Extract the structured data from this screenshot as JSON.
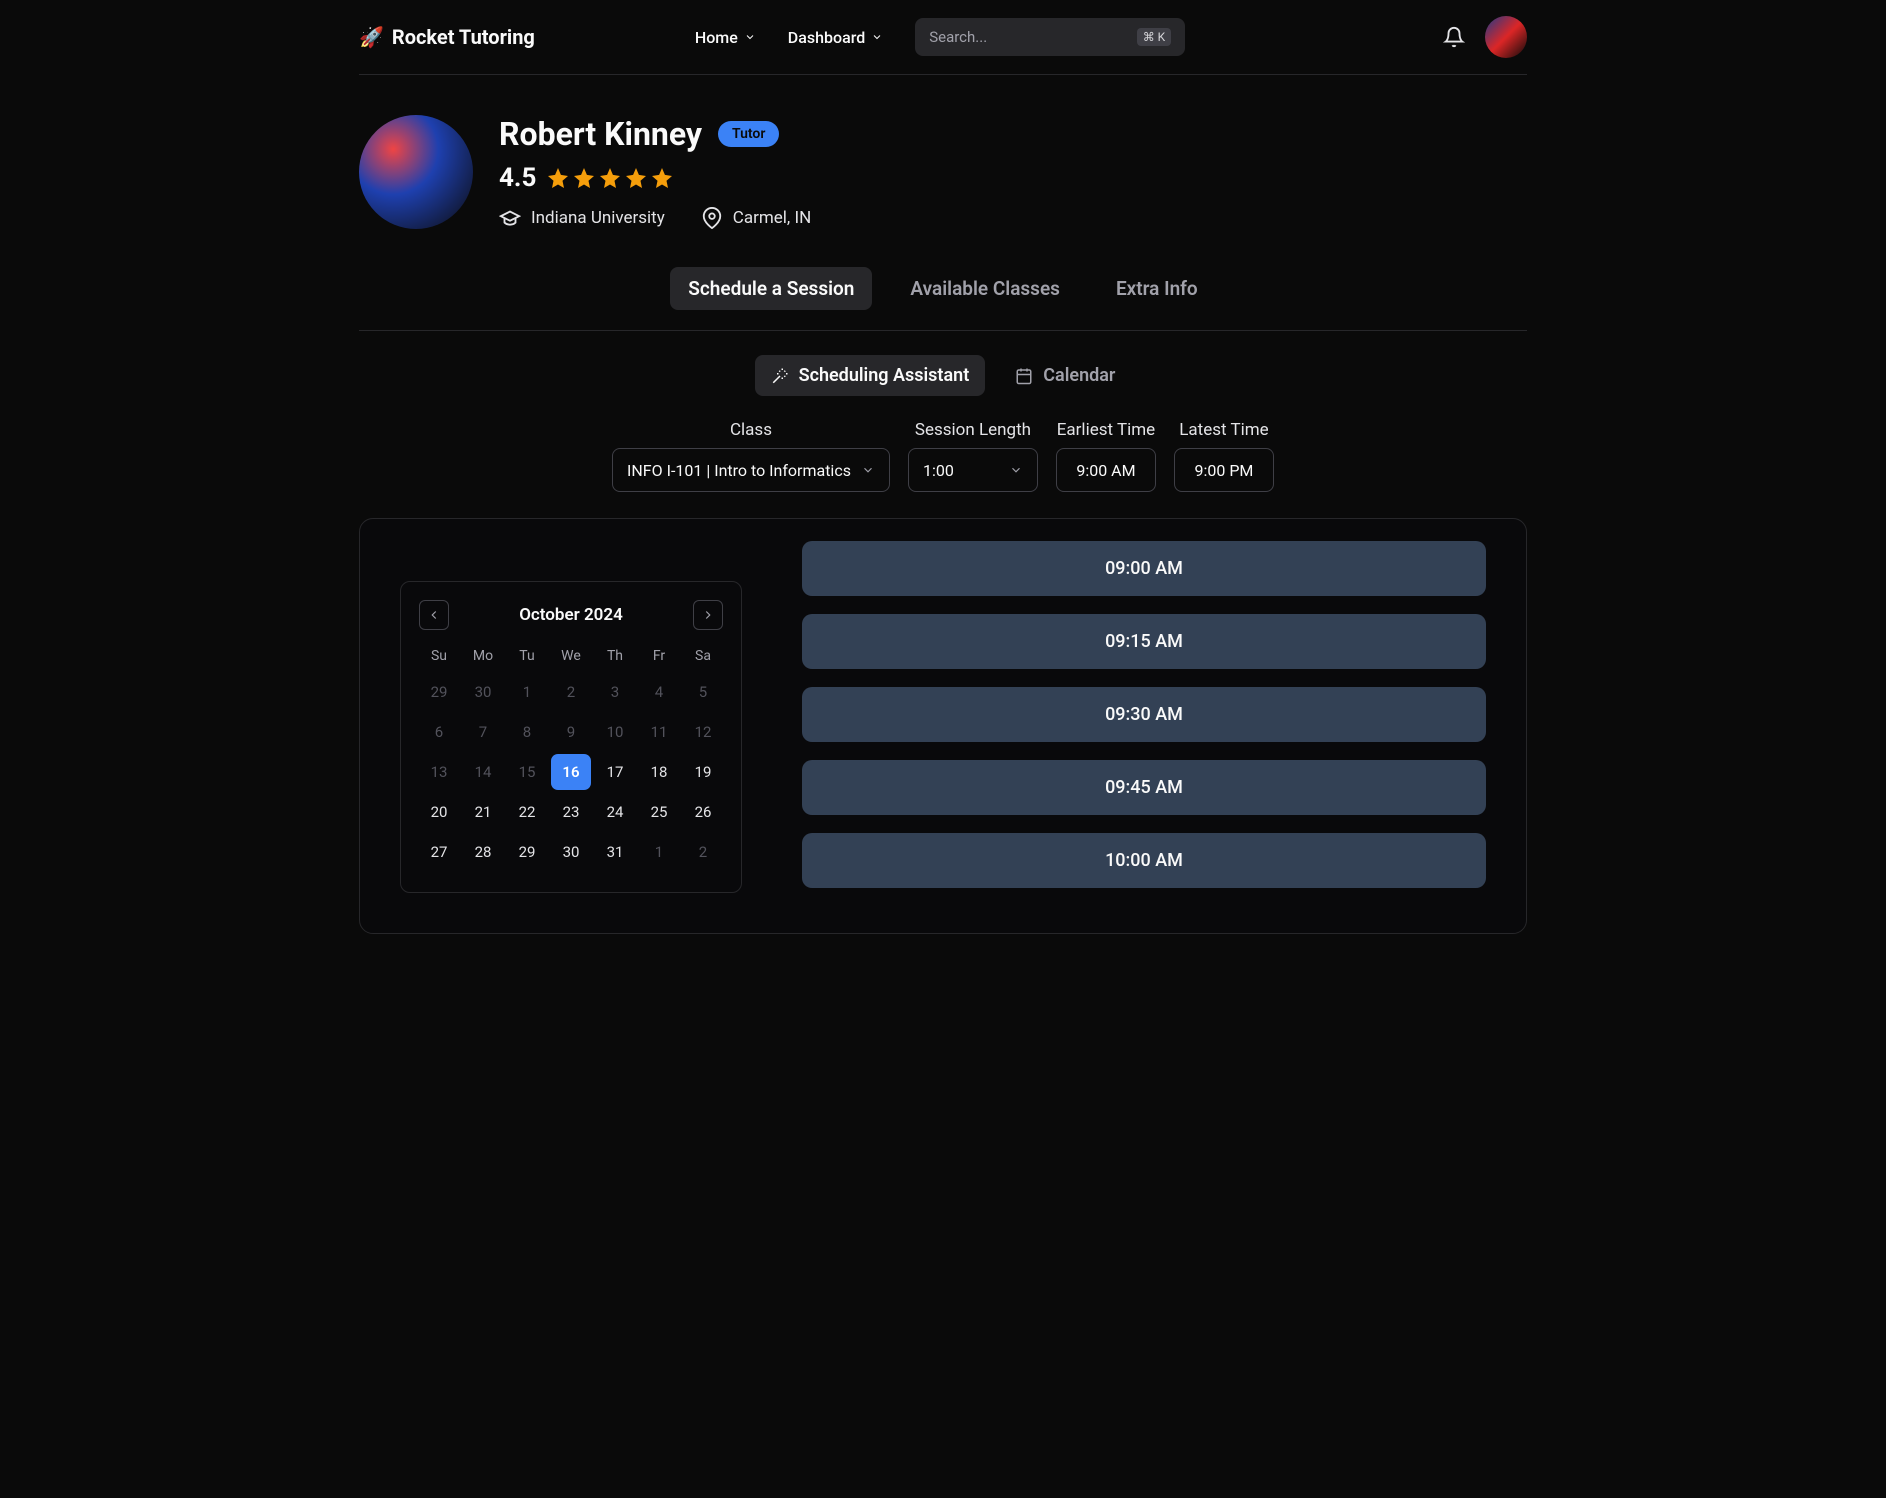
{
  "header": {
    "brand_emoji": "🚀",
    "brand_name": "Rocket Tutoring",
    "nav": [
      {
        "label": "Home"
      },
      {
        "label": "Dashboard"
      }
    ],
    "search_placeholder": "Search...",
    "search_kbd": "⌘ K"
  },
  "profile": {
    "name": "Robert Kinney",
    "badge": "Tutor",
    "rating": "4.5",
    "university": "Indiana University",
    "location": "Carmel, IN"
  },
  "tabs": [
    {
      "label": "Schedule a Session",
      "active": true
    },
    {
      "label": "Available Classes",
      "active": false
    },
    {
      "label": "Extra Info",
      "active": false
    }
  ],
  "subtabs": [
    {
      "label": "Scheduling Assistant",
      "active": true,
      "icon": "wand-icon"
    },
    {
      "label": "Calendar",
      "active": false,
      "icon": "calendar-icon"
    }
  ],
  "filters": {
    "class_label": "Class",
    "class_value": "INFO I-101 | Intro to Informatics",
    "session_length_label": "Session Length",
    "session_length_value": "1:00",
    "earliest_label": "Earliest Time",
    "earliest_value": "9:00 AM",
    "latest_label": "Latest Time",
    "latest_value": "9:00 PM"
  },
  "calendar": {
    "month_label": "October 2024",
    "dows": [
      "Su",
      "Mo",
      "Tu",
      "We",
      "Th",
      "Fr",
      "Sa"
    ],
    "days": [
      {
        "n": "29",
        "muted": true
      },
      {
        "n": "30",
        "muted": true
      },
      {
        "n": "1",
        "muted": true
      },
      {
        "n": "2",
        "muted": true
      },
      {
        "n": "3",
        "muted": true
      },
      {
        "n": "4",
        "muted": true
      },
      {
        "n": "5",
        "muted": true
      },
      {
        "n": "6",
        "muted": true
      },
      {
        "n": "7",
        "muted": true
      },
      {
        "n": "8",
        "muted": true
      },
      {
        "n": "9",
        "muted": true
      },
      {
        "n": "10",
        "muted": true
      },
      {
        "n": "11",
        "muted": true
      },
      {
        "n": "12",
        "muted": true
      },
      {
        "n": "13",
        "muted": true
      },
      {
        "n": "14",
        "muted": true
      },
      {
        "n": "15",
        "muted": true
      },
      {
        "n": "16",
        "selected": true
      },
      {
        "n": "17"
      },
      {
        "n": "18"
      },
      {
        "n": "19"
      },
      {
        "n": "20"
      },
      {
        "n": "21"
      },
      {
        "n": "22"
      },
      {
        "n": "23"
      },
      {
        "n": "24"
      },
      {
        "n": "25"
      },
      {
        "n": "26"
      },
      {
        "n": "27"
      },
      {
        "n": "28"
      },
      {
        "n": "29"
      },
      {
        "n": "30"
      },
      {
        "n": "31"
      },
      {
        "n": "1",
        "muted": true
      },
      {
        "n": "2",
        "muted": true
      }
    ]
  },
  "slots": [
    "09:00 AM",
    "09:15 AM",
    "09:30 AM",
    "09:45 AM",
    "10:00 AM"
  ]
}
